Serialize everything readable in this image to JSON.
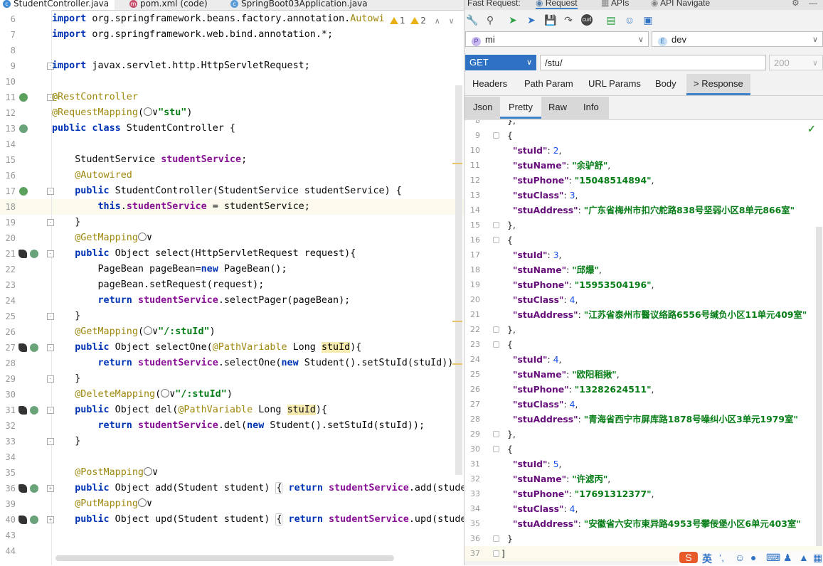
{
  "editor": {
    "tabs": [
      {
        "label": "StudentController.java",
        "icon": "java-class-icon",
        "active": true
      },
      {
        "label": "pom.xml (code)",
        "icon": "maven-icon",
        "active": false
      },
      {
        "label": "SpringBoot03Application.java",
        "icon": "spring-class-icon",
        "active": false
      }
    ],
    "inspection": {
      "warn1": "1",
      "warn2": "2"
    },
    "lines": [
      {
        "n": "6",
        "html": "<span class=\"kw\">import</span> org.springframework.beans.factory.annotation.<span class=\"an\">Autowi</span>"
      },
      {
        "n": "7",
        "html": "<span class=\"kw\">import</span> org.springframework.web.bind.annotation.*;"
      },
      {
        "n": "8",
        "html": ""
      },
      {
        "n": "9",
        "html": "<span class=\"kw\">import</span> javax.servlet.http.HttpServletRequest;",
        "fold": "-"
      },
      {
        "n": "10",
        "html": ""
      },
      {
        "n": "11",
        "html": "<span class=\"an\">@RestController</span>",
        "icon": "bean",
        "fold": "-"
      },
      {
        "n": "12",
        "html": "<span class=\"an\">@RequestMapping</span>(<span class=\"ic\"></span>∨<span class=\"st\">\"stu\"</span>)"
      },
      {
        "n": "13",
        "html": "<span class=\"kw\">public class</span> StudentController {",
        "icon": "globe"
      },
      {
        "n": "14",
        "html": ""
      },
      {
        "n": "15",
        "html": "    StudentService <span class=\"fd\">studentService</span>;"
      },
      {
        "n": "16",
        "html": "    <span class=\"an\">@Autowired</span>"
      },
      {
        "n": "17",
        "html": "    <span class=\"kw\">public</span> StudentController(StudentService studentService) {",
        "icon": "bean",
        "fold": "-"
      },
      {
        "n": "18",
        "html": "        <span class=\"kw\">this</span>.<span class=\"fd\">studentService</span> = studentService;",
        "hl": true
      },
      {
        "n": "19",
        "html": "    }",
        "fold": "-"
      },
      {
        "n": "20",
        "html": "    <span class=\"an\">@GetMapping</span><span class=\"ic\"></span>∨"
      },
      {
        "n": "21",
        "html": "    <span class=\"kw\">public</span> Object select(HttpServletRequest request){",
        "icon": "rocket",
        "fold": "-"
      },
      {
        "n": "22",
        "html": "        PageBean pageBean=<span class=\"kw\">new</span> PageBean();"
      },
      {
        "n": "23",
        "html": "        pageBean.setRequest(request);"
      },
      {
        "n": "24",
        "html": "        <span class=\"kw\">return</span> <span class=\"fd\">studentService</span>.selectPager(pageBean);"
      },
      {
        "n": "25",
        "html": "    }",
        "fold": "-"
      },
      {
        "n": "26",
        "html": "    <span class=\"an\">@GetMapping</span>(<span class=\"ic\"></span>∨<span class=\"st\">\"/:stuId\"</span>)"
      },
      {
        "n": "27",
        "html": "    <span class=\"kw\">public</span> Object selectOne(<span class=\"an\">@PathVariable</span> Long <span class=\"hlv\">stuId</span>){",
        "icon": "rocket",
        "fold": "-"
      },
      {
        "n": "28",
        "html": "        <span class=\"kw\">return</span> <span class=\"fd\">studentService</span>.selectOne(<span class=\"kw\">new</span> Student().setStuId(stuId));"
      },
      {
        "n": "29",
        "html": "    }",
        "fold": "-"
      },
      {
        "n": "30",
        "html": "    <span class=\"an\">@DeleteMapping</span>(<span class=\"ic\"></span>∨<span class=\"st\">\"/:stuId\"</span>)"
      },
      {
        "n": "31",
        "html": "    <span class=\"kw\">public</span> Object del(<span class=\"an\">@PathVariable</span> Long <span class=\"hlv\">stuId</span>){",
        "icon": "rocket",
        "fold": "-"
      },
      {
        "n": "32",
        "html": "        <span class=\"kw\">return</span> <span class=\"fd\">studentService</span>.del(<span class=\"kw\">new</span> Student().setStuId(stuId));"
      },
      {
        "n": "33",
        "html": "    }",
        "fold": "-"
      },
      {
        "n": "34",
        "html": ""
      },
      {
        "n": "35",
        "html": "    <span class=\"an\">@PostMapping</span><span class=\"ic\"></span>∨"
      },
      {
        "n": "36",
        "html": "    <span class=\"kw\">public</span> Object add(Student student) <span class=\"bx\">{</span> <span class=\"kw\">return</span> <span class=\"fd\">studentService</span>.add(student); <span class=\"bx\">}</span>",
        "icon": "rocket",
        "fold": "+"
      },
      {
        "n": "39",
        "html": "    <span class=\"an\">@PutMapping</span><span class=\"ic\"></span>∨"
      },
      {
        "n": "40",
        "html": "    <span class=\"kw\">public</span> Object upd(Student student) <span class=\"bx\">{</span> <span class=\"kw\">return</span> <span class=\"fd\">studentService</span>.upd(student); <span class=\"bx\">}</span>",
        "icon": "rocket",
        "fold": "+"
      },
      {
        "n": "43",
        "html": ""
      },
      {
        "n": "44",
        "html": ""
      }
    ]
  },
  "panel": {
    "title_tabs": [
      "Fast Request:",
      "Request",
      "APIs",
      "API Navigate"
    ],
    "toolbar_icons": [
      "wrench-icon",
      "search-icon",
      "send-icon",
      "send-debug-icon",
      "save-icon",
      "redo-icon",
      "curl-icon",
      "doc-icon",
      "add-user-icon",
      "gift-icon"
    ],
    "project": {
      "badge": "P",
      "label": "mi",
      "color": "#c7b8ee"
    },
    "env": {
      "badge": "E",
      "label": "dev",
      "color": "#c9e0f5"
    },
    "method": "GET",
    "url": "/stu/",
    "status": "200",
    "tabs": [
      "Headers",
      "Path Param",
      "URL Params",
      "Body",
      "> Response"
    ],
    "subtabs": [
      "Json",
      "Pretty",
      "Raw",
      "Info"
    ],
    "response_lines": [
      {
        "n": "8",
        "t": [
          [
            "p",
            "},"
          ]
        ],
        "ind": 2
      },
      {
        "n": "9",
        "t": [
          [
            "p",
            "{"
          ]
        ],
        "ind": 2,
        "fold": true
      },
      {
        "n": "10",
        "t": [
          [
            "k",
            "\"stuId\""
          ],
          [
            "p",
            ": "
          ],
          [
            "n",
            "2"
          ],
          [
            "p",
            ","
          ]
        ],
        "ind": 3
      },
      {
        "n": "11",
        "t": [
          [
            "k",
            "\"stuName\""
          ],
          [
            "p",
            ": "
          ],
          [
            "s",
            "\"余驴舒\""
          ],
          [
            "p",
            ","
          ]
        ],
        "ind": 3
      },
      {
        "n": "12",
        "t": [
          [
            "k",
            "\"stuPhone\""
          ],
          [
            "p",
            ": "
          ],
          [
            "s",
            "\"15048514894\""
          ],
          [
            "p",
            ","
          ]
        ],
        "ind": 3
      },
      {
        "n": "13",
        "t": [
          [
            "k",
            "\"stuClass\""
          ],
          [
            "p",
            ": "
          ],
          [
            "n",
            "3"
          ],
          [
            "p",
            ","
          ]
        ],
        "ind": 3
      },
      {
        "n": "14",
        "t": [
          [
            "k",
            "\"stuAddress\""
          ],
          [
            "p",
            ": "
          ],
          [
            "s",
            "\"广东省梅州市扣穴舵路838号坚弱小区8单元866室\""
          ]
        ],
        "ind": 3
      },
      {
        "n": "15",
        "t": [
          [
            "p",
            "},"
          ]
        ],
        "ind": 2,
        "fold": true
      },
      {
        "n": "16",
        "t": [
          [
            "p",
            "{"
          ]
        ],
        "ind": 2,
        "fold": true
      },
      {
        "n": "17",
        "t": [
          [
            "k",
            "\"stuId\""
          ],
          [
            "p",
            ": "
          ],
          [
            "n",
            "3"
          ],
          [
            "p",
            ","
          ]
        ],
        "ind": 3
      },
      {
        "n": "18",
        "t": [
          [
            "k",
            "\"stuName\""
          ],
          [
            "p",
            ": "
          ],
          [
            "s",
            "\"邱爆\""
          ],
          [
            "p",
            ","
          ]
        ],
        "ind": 3
      },
      {
        "n": "19",
        "t": [
          [
            "k",
            "\"stuPhone\""
          ],
          [
            "p",
            ": "
          ],
          [
            "s",
            "\"15953504196\""
          ],
          [
            "p",
            ","
          ]
        ],
        "ind": 3
      },
      {
        "n": "20",
        "t": [
          [
            "k",
            "\"stuClass\""
          ],
          [
            "p",
            ": "
          ],
          [
            "n",
            "4"
          ],
          [
            "p",
            ","
          ]
        ],
        "ind": 3
      },
      {
        "n": "21",
        "t": [
          [
            "k",
            "\"stuAddress\""
          ],
          [
            "p",
            ": "
          ],
          [
            "s",
            "\"江苏省泰州市醫议络路6556号缄负小区11单元409室\""
          ]
        ],
        "ind": 3
      },
      {
        "n": "22",
        "t": [
          [
            "p",
            "},"
          ]
        ],
        "ind": 2,
        "fold": true
      },
      {
        "n": "23",
        "t": [
          [
            "p",
            "{"
          ]
        ],
        "ind": 2,
        "fold": true
      },
      {
        "n": "24",
        "t": [
          [
            "k",
            "\"stuId\""
          ],
          [
            "p",
            ": "
          ],
          [
            "n",
            "4"
          ],
          [
            "p",
            ","
          ]
        ],
        "ind": 3
      },
      {
        "n": "25",
        "t": [
          [
            "k",
            "\"stuName\""
          ],
          [
            "p",
            ": "
          ],
          [
            "s",
            "\"欧阳稻揪\""
          ],
          [
            "p",
            ","
          ]
        ],
        "ind": 3
      },
      {
        "n": "26",
        "t": [
          [
            "k",
            "\"stuPhone\""
          ],
          [
            "p",
            ": "
          ],
          [
            "s",
            "\"13282624511\""
          ],
          [
            "p",
            ","
          ]
        ],
        "ind": 3
      },
      {
        "n": "27",
        "t": [
          [
            "k",
            "\"stuClass\""
          ],
          [
            "p",
            ": "
          ],
          [
            "n",
            "4"
          ],
          [
            "p",
            ","
          ]
        ],
        "ind": 3
      },
      {
        "n": "28",
        "t": [
          [
            "k",
            "\"stuAddress\""
          ],
          [
            "p",
            ": "
          ],
          [
            "s",
            "\"青海省西宁市屏库路1878号噪纠小区3单元1979室\""
          ]
        ],
        "ind": 3
      },
      {
        "n": "29",
        "t": [
          [
            "p",
            "},"
          ]
        ],
        "ind": 2,
        "fold": true
      },
      {
        "n": "30",
        "t": [
          [
            "p",
            "{"
          ]
        ],
        "ind": 2,
        "fold": true
      },
      {
        "n": "31",
        "t": [
          [
            "k",
            "\"stuId\""
          ],
          [
            "p",
            ": "
          ],
          [
            "n",
            "5"
          ],
          [
            "p",
            ","
          ]
        ],
        "ind": 3
      },
      {
        "n": "32",
        "t": [
          [
            "k",
            "\"stuName\""
          ],
          [
            "p",
            ": "
          ],
          [
            "s",
            "\"许滤丙\""
          ],
          [
            "p",
            ","
          ]
        ],
        "ind": 3
      },
      {
        "n": "33",
        "t": [
          [
            "k",
            "\"stuPhone\""
          ],
          [
            "p",
            ": "
          ],
          [
            "s",
            "\"17691312377\""
          ],
          [
            "p",
            ","
          ]
        ],
        "ind": 3
      },
      {
        "n": "34",
        "t": [
          [
            "k",
            "\"stuClass\""
          ],
          [
            "p",
            ": "
          ],
          [
            "n",
            "4"
          ],
          [
            "p",
            ","
          ]
        ],
        "ind": 3
      },
      {
        "n": "35",
        "t": [
          [
            "k",
            "\"stuAddress\""
          ],
          [
            "p",
            ": "
          ],
          [
            "s",
            "\"安徽省六安市柬异路4953号攀佞堡小区6单元403室\""
          ]
        ],
        "ind": 3
      },
      {
        "n": "36",
        "t": [
          [
            "p",
            "}"
          ]
        ],
        "ind": 2,
        "fold": true
      },
      {
        "n": "37",
        "t": [
          [
            "p",
            "]"
          ]
        ],
        "ind": 1,
        "fold": true,
        "hl": true
      }
    ],
    "ime": {
      "logo": "S",
      "lang": "英"
    }
  }
}
